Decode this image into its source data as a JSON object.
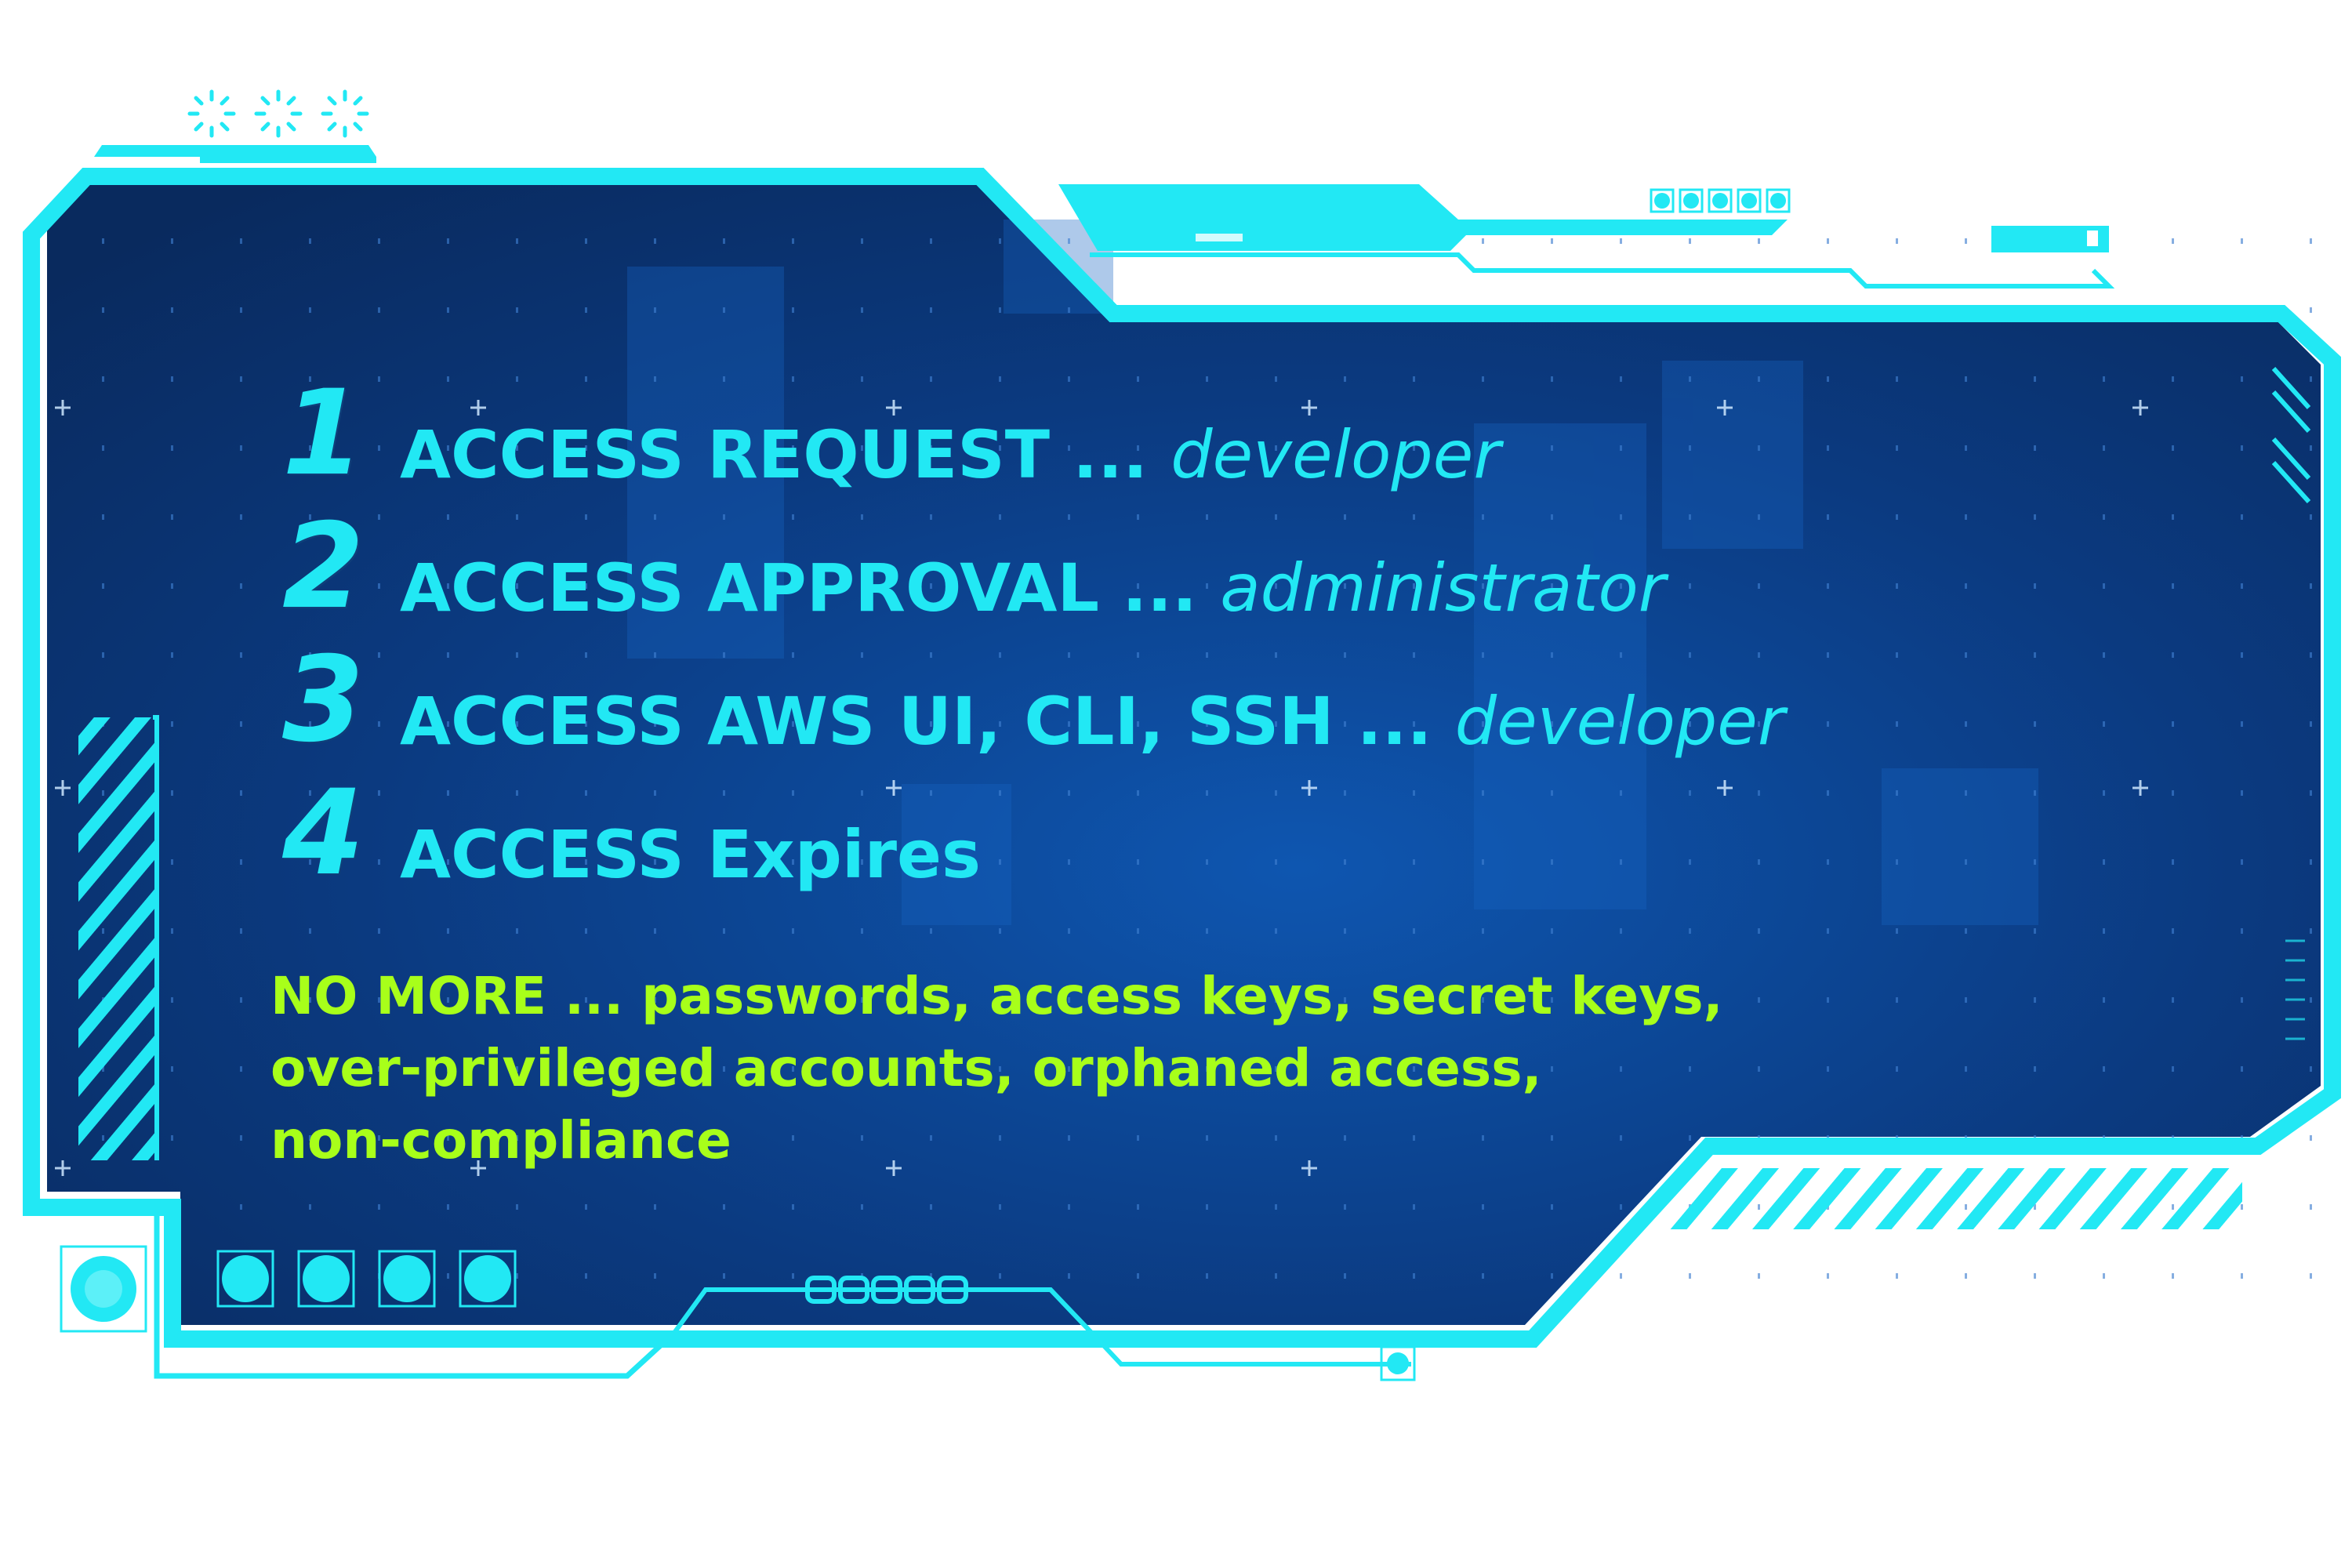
{
  "colors": {
    "frame": "#22e8f4",
    "panel_dark": "#0a2a5e",
    "panel_light": "#0d4fa8",
    "step_text": "#22e8f4",
    "no_more_text": "#a8ff1a"
  },
  "steps": [
    {
      "num": "1",
      "action": "ACCESS REQUEST ...",
      "role": "developer"
    },
    {
      "num": "2",
      "action": "ACCESS APPROVAL ...",
      "role": "administrator"
    },
    {
      "num": "3",
      "action": "ACCESS AWS UI, CLI, SSH ...",
      "role": "developer"
    },
    {
      "num": "4",
      "action": "ACCESS Expires",
      "role": ""
    }
  ],
  "no_more": {
    "lines": [
      "NO MORE ... passwords, access keys, secret keys,",
      "over-privileged accounts, orphaned access,",
      "non-compliance"
    ]
  },
  "hud_decor": {
    "top_loader_icons": 3,
    "top_dot_indicators": 5,
    "bottom_left_circle_buttons": 4,
    "bottom_center_pill_count": 5
  }
}
